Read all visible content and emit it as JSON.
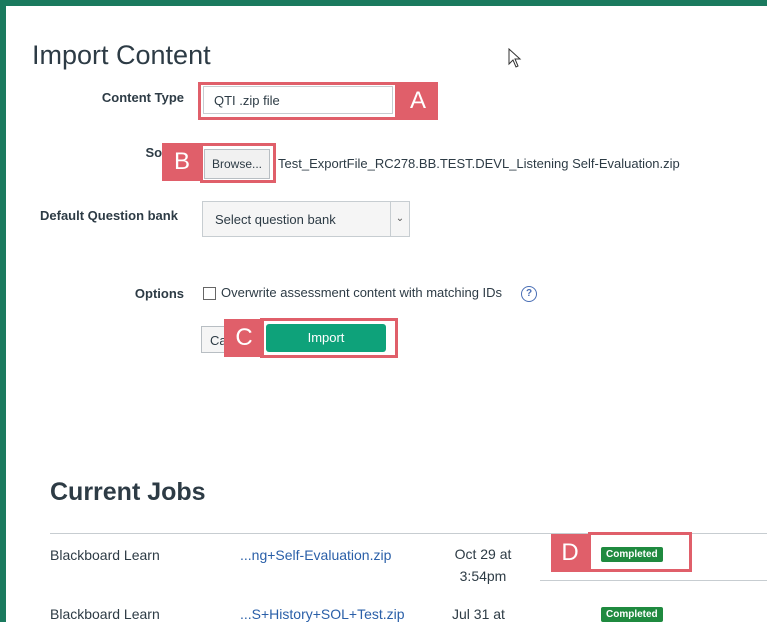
{
  "page": {
    "title": "Import Content"
  },
  "form": {
    "content_type_label": "Content Type",
    "content_type_value": "QTI .zip file",
    "source_label": "Sou",
    "browse_label": "Browse...",
    "file_name": "Test_ExportFile_RC278.BB.TEST.DEVL_Listening Self-Evaluation.zip",
    "qbank_label": "Default Question bank",
    "qbank_value": "Select question bank",
    "options_label": "Options",
    "overwrite_label": "Overwrite assessment content with matching IDs",
    "help_symbol": "?",
    "cancel_label": "Ca",
    "import_label": "Import"
  },
  "callouts": {
    "a": "A",
    "b": "B",
    "c": "C",
    "d": "D"
  },
  "jobs": {
    "title": "Current Jobs",
    "rows": [
      {
        "type": "Blackboard Learn",
        "file": "...ng+Self-Evaluation.zip",
        "date": "Oct 29 at 3:54pm",
        "status": "Completed"
      },
      {
        "type": "Blackboard Learn",
        "file": "...S+History+SOL+Test.zip",
        "date": "Jul 31 at",
        "status": "Completed"
      }
    ]
  },
  "colors": {
    "accent_green": "#0ea27a",
    "frame_green": "#1a7a5e",
    "callout_red": "#e05f6a",
    "badge_green": "#1f8a3f"
  }
}
